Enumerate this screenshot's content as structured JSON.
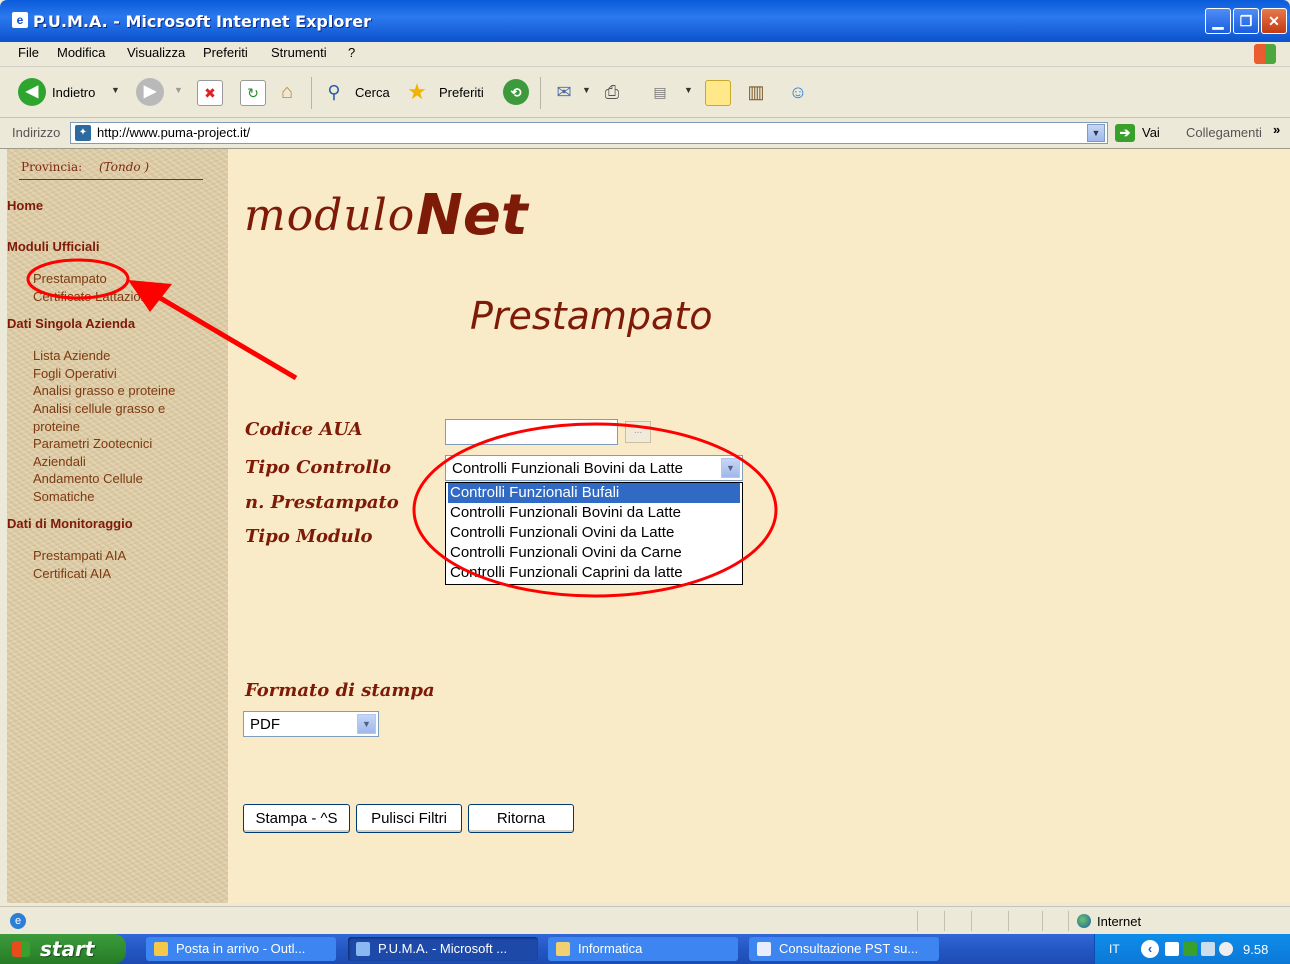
{
  "window": {
    "title": "P.U.M.A. - Microsoft Internet Explorer",
    "title_icon": "ie-page-icon",
    "controls": {
      "minimize": "▁",
      "maximize": "❐",
      "close": "✕"
    }
  },
  "menubar": [
    "File",
    "Modifica",
    "Visualizza",
    "Preferiti",
    "Strumenti",
    "?"
  ],
  "toolbar": {
    "back_label": "Indietro",
    "search_label": "Cerca",
    "favorites_label": "Preferiti"
  },
  "address": {
    "label": "Indirizzo",
    "url": "http://www.puma-project.it/",
    "go_label": "Vai",
    "links_label": "Collegamenti",
    "links_chevron": "»"
  },
  "sidebar": {
    "provincia_label": "Provincia:",
    "provincia_value": "(Tondo )",
    "home": "Home",
    "moduli_ufficiali": "Moduli Ufficiali",
    "moduli_links": [
      "Prestampato",
      "Certificato Lattazione"
    ],
    "dati_singola_azienda": "Dati Singola Azienda",
    "azienda_links": [
      "Lista Aziende",
      "Fogli Operativi",
      "Analisi grasso e proteine",
      "Analisi cellule grasso e proteine",
      "Parametri Zootecnici Aziendali",
      "Andamento Cellule Somatiche"
    ],
    "dati_monitoraggio": "Dati di Monitoraggio",
    "monitoraggio_links": [
      "Prestampati AIA",
      "Certificati AIA"
    ]
  },
  "main": {
    "logo_modulo": "modulo",
    "logo_net": "Net",
    "page_title": "Prestampato",
    "labels": {
      "codice_aua": "Codice AUA",
      "tipo_controllo": "Tipo Controllo",
      "n_prestampato": "n. Prestampato",
      "tipo_modulo": "Tipo Modulo",
      "formato_stampa": "Formato di stampa"
    },
    "codice_aua_value": "",
    "codice_btn": "...",
    "tipo_controllo_selected": "Controlli Funzionali Bovini da Latte",
    "tipo_controllo_options": [
      "Controlli Funzionali Bufali",
      "Controlli Funzionali Bovini da Latte",
      "Controlli Funzionali Ovini da Latte",
      "Controlli Funzionali Ovini da Carne",
      "Controlli Funzionali Caprini da latte"
    ],
    "tipo_controllo_highlighted_index": 0,
    "formato_selected": "PDF",
    "buttons": {
      "stampa": "Stampa - ^S",
      "pulisci": "Pulisci Filtri",
      "ritorna": "Ritorna"
    }
  },
  "statusbar": {
    "zone": "Internet"
  },
  "taskbar": {
    "start": "start",
    "tasks": [
      "Posta in arrivo - Outl...",
      "P.U.M.A. - Microsoft ...",
      "Informatica",
      "Consultazione PST su..."
    ],
    "active_task_index": 1,
    "tray_lang": "IT",
    "clock": "9.58"
  },
  "colors": {
    "content_bg": "#faebc8",
    "sidebar_bg": "#dccaa3",
    "brand": "#7d1a08",
    "annotation": "#ff0000",
    "selection": "#316ac5"
  }
}
